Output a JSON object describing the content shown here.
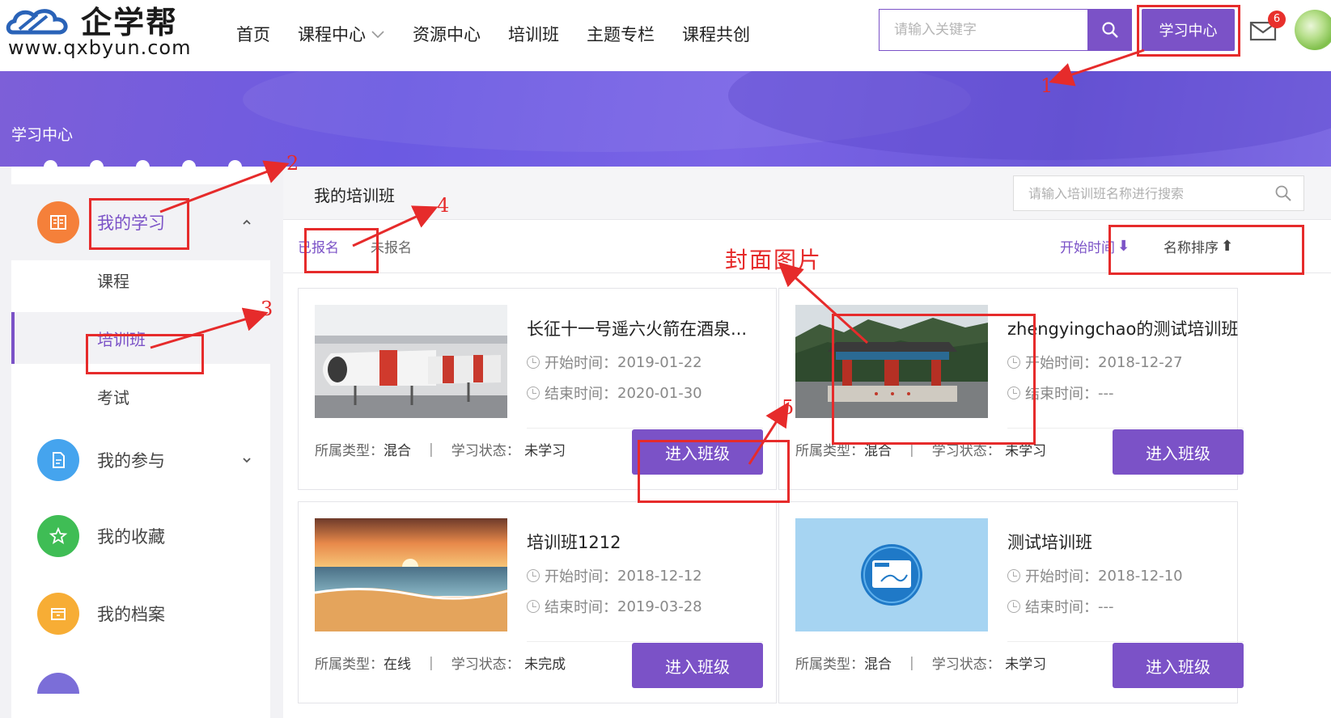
{
  "header": {
    "logo_cn": "企学帮",
    "logo_en": "www.qxbyun.com",
    "nav": [
      "首页",
      "课程中心",
      "资源中心",
      "培训班",
      "主题专栏",
      "课程共创"
    ],
    "search_placeholder": "请输入关键字",
    "learn_center_label": "学习中心",
    "mail_badge": "6"
  },
  "banner": {
    "title": "学习中心"
  },
  "sidebar": {
    "groups": [
      {
        "label": "我的学习",
        "icon": "book-icon"
      },
      {
        "label": "我的参与",
        "icon": "document-icon"
      },
      {
        "label": "我的收藏",
        "icon": "star-icon"
      },
      {
        "label": "我的档案",
        "icon": "folder-icon"
      }
    ],
    "sub_items": [
      "课程",
      "培训班",
      "考试"
    ]
  },
  "main": {
    "title": "我的培训班",
    "search_placeholder": "请输入培训班名称进行搜索",
    "tabs": [
      "已报名",
      "未报名"
    ],
    "sort": [
      {
        "label": "开始时间",
        "arrow": "⬇"
      },
      {
        "label": "名称排序",
        "arrow": "⬆"
      }
    ]
  },
  "card_labels": {
    "start": "开始时间：",
    "end": "结束时间：",
    "type": "所属类型：",
    "status": "学习状态：",
    "separator": "|",
    "enter": "进入班级"
  },
  "cards": [
    {
      "title": "长征十一号遥六火箭在酒泉...",
      "start": "2019-01-22",
      "end": "2020-01-30",
      "type": "混合",
      "status": "未学习",
      "image": "rocket-photo"
    },
    {
      "title": "zhengyingchao的测试培训班",
      "start": "2018-12-27",
      "end": "---",
      "type": "混合",
      "status": "未学习",
      "image": "gate-photo"
    },
    {
      "title": "培训班1212",
      "start": "2018-12-12",
      "end": "2019-03-28",
      "type": "在线",
      "status": "未完成",
      "image": "beach-photo"
    },
    {
      "title": "测试培训班",
      "start": "2018-12-10",
      "end": "---",
      "type": "混合",
      "status": "未学习",
      "image": "default-cover"
    }
  ],
  "annotations": {
    "numbers": [
      "1",
      "2",
      "3",
      "4",
      "5"
    ],
    "cover_label": "封面图片",
    "color": "#e62b2b"
  },
  "colors": {
    "accent": "#7b52c7",
    "banner": "#6b5ae2",
    "badge": "#e8302c"
  }
}
